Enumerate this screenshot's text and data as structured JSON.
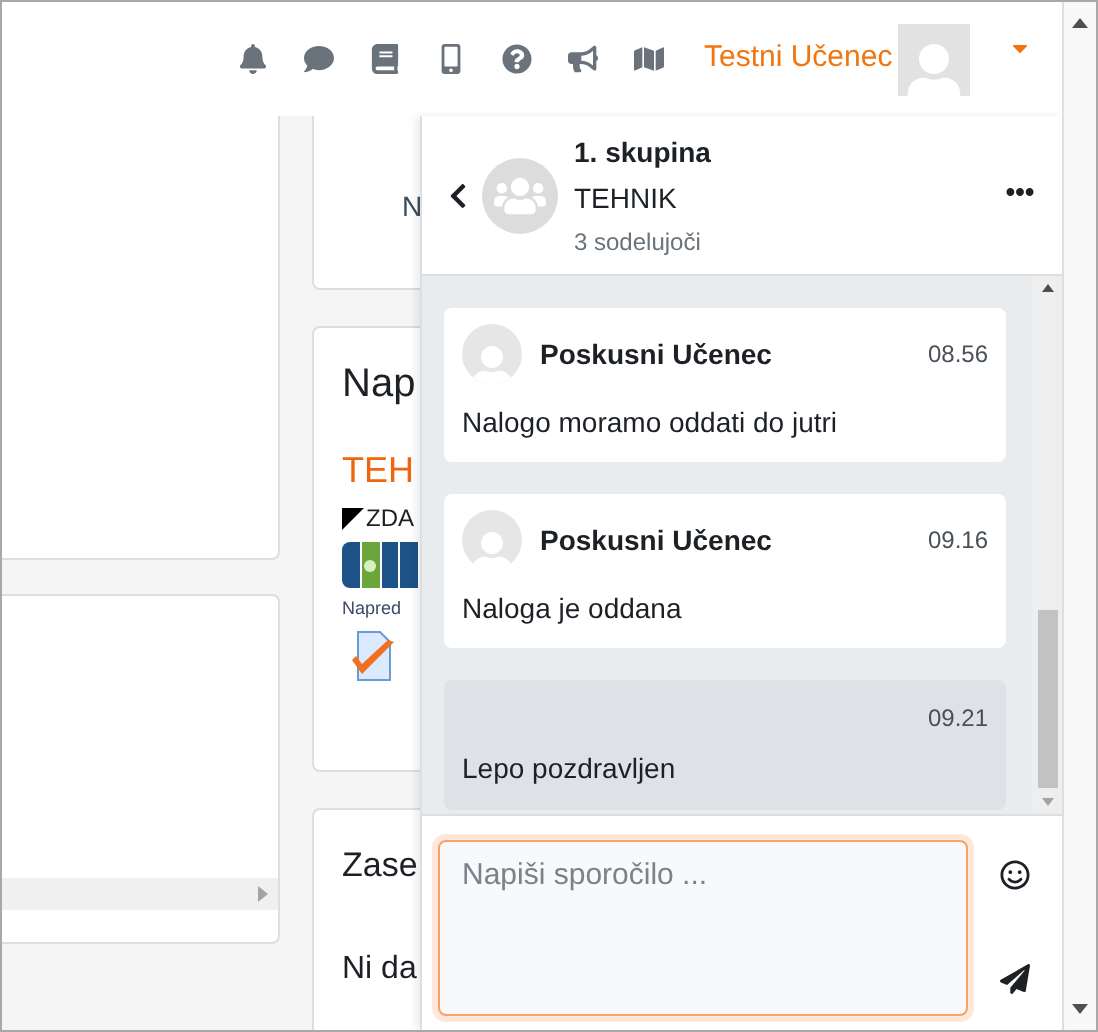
{
  "navbar": {
    "user_name": "Testni Učenec"
  },
  "background": {
    "top_card": {
      "text": "N"
    },
    "course_card": {
      "title": "Nap",
      "course": "TEH",
      "section": "ZDA",
      "progress_label": "Napred",
      "progress_segments": [
        {
          "completed": false
        },
        {
          "completed": true
        },
        {
          "completed": false
        },
        {
          "completed": false
        }
      ]
    },
    "events_card": {
      "title": "Zase",
      "text": "Ni da"
    }
  },
  "drawer": {
    "title": "1. skupina",
    "subtitle": "TEHNIK",
    "participants": "3 sodelujoči",
    "messages": [
      {
        "kind": "received",
        "sender": "Poskusni Učenec",
        "time": "08.56",
        "text": "Nalogo moramo oddati do jutri"
      },
      {
        "kind": "received",
        "sender": "Poskusni Učenec",
        "time": "09.16",
        "text": "Naloga je oddana"
      },
      {
        "kind": "sent",
        "time": "09.21",
        "text": "Lepo pozdravljen"
      }
    ],
    "composer": {
      "placeholder": "Napiši sporočilo ..."
    }
  }
}
